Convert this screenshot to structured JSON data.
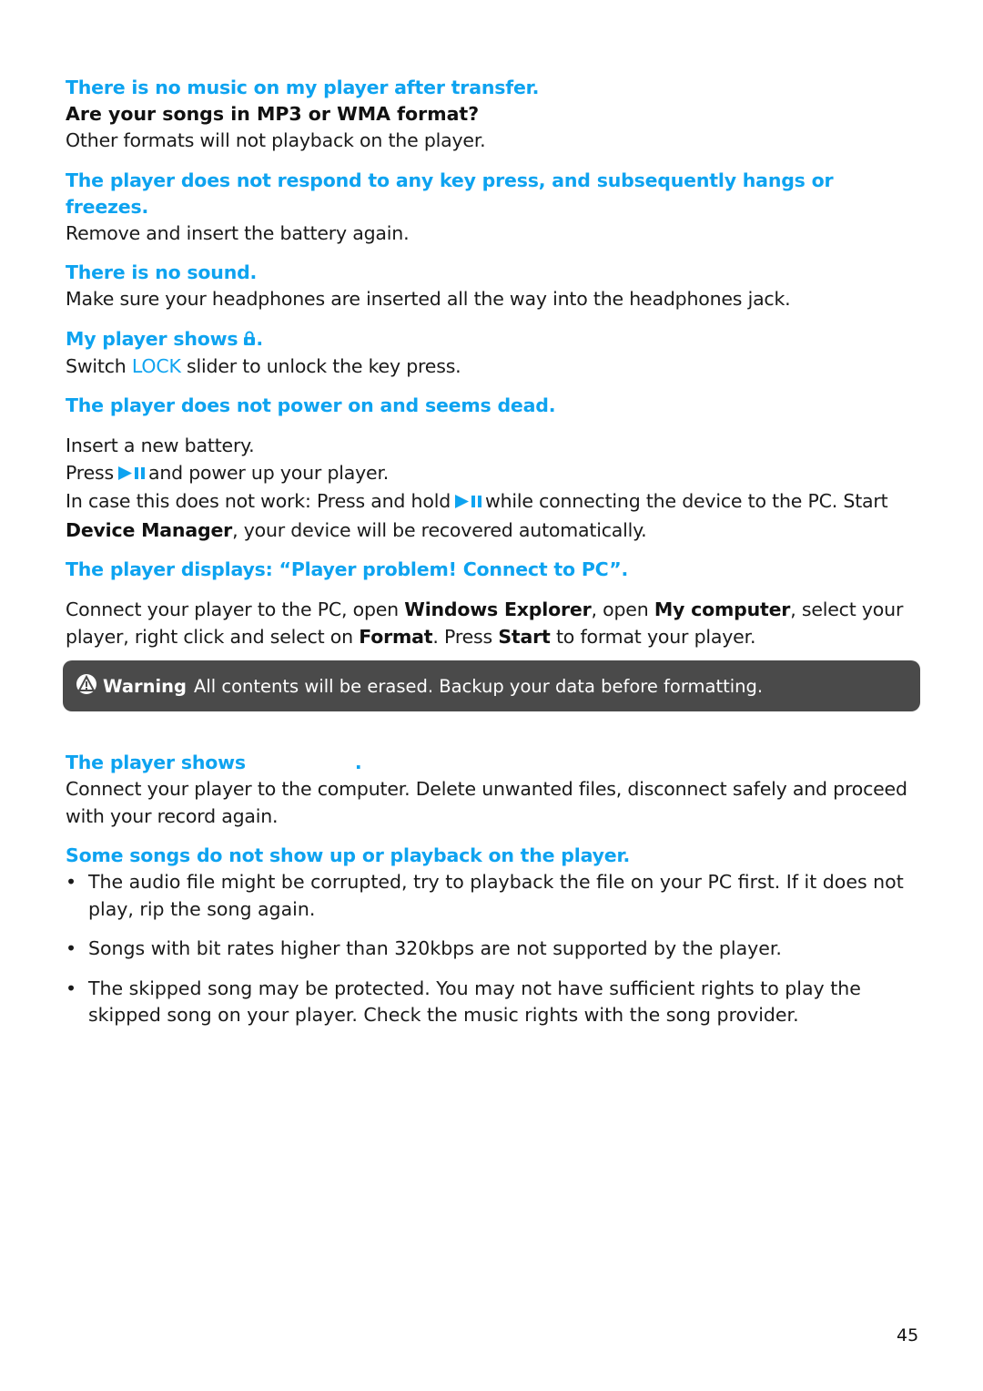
{
  "sections": [
    {
      "heading": "There is no music on my player after transfer.",
      "subheading": "Are your songs in MP3 or WMA format?",
      "body": "Other formats will not playback on the player."
    },
    {
      "heading": "The player does not respond to any key press, and subsequently hangs or freezes.",
      "body": "Remove and insert the battery again."
    },
    {
      "heading": "There is no sound.",
      "body": "Make sure your headphones are inserted all the way into the headphones jack."
    },
    {
      "heading_prefix": "My player shows",
      "heading_suffix": ".",
      "body_prefix": "Switch",
      "body_highlight": "LOCK",
      "body_suffix": "slider to unlock the key press."
    },
    {
      "heading": "The player does not power on and seems dead.",
      "line1": "Insert a new battery.",
      "line2_prefix": "Press",
      "line2_suffix": "and power up your player.",
      "line3_prefix": "In case this does not work: Press and hold",
      "line3_suffix": "while connecting the device to the PC. Start",
      "line4_bold": "Device Manager",
      "line4_suffix": ", your device will be recovered automatically."
    },
    {
      "heading": "The player displays: “Player problem! Connect to PC”.",
      "parts": {
        "t1": "Connect your player to the PC, open ",
        "b1": "Windows Explorer",
        "t2": ", open ",
        "b2": "My computer",
        "t3": ", select your player, right click and select on ",
        "b3": "Format",
        "t4": ". Press ",
        "b4": "Start",
        "t5": " to format your player."
      }
    },
    {
      "heading_prefix": "The player shows",
      "heading_suffix": ".",
      "body": "Connect your player to the computer. Delete unwanted files, disconnect safely and proceed with your record again."
    },
    {
      "heading": "Some songs do not show up or playback on the player.",
      "bullets": [
        "The audio file might be corrupted, try to playback the file on your PC first. If it does not play, rip the song again.",
        "Songs with bit rates higher than 320kbps are not supported by the player.",
        "The skipped song may be protected. You may not have sufficient rights to play the skipped song on your player. Check the music rights with the song provider."
      ]
    }
  ],
  "warning": {
    "label": "Warning",
    "text": "All contents will be erased. Backup your data before formatting.",
    "icon": "warning-triangle-icon"
  },
  "bullet_char": "•",
  "page_number": "45",
  "colors": {
    "heading_blue": "#0ea3f0",
    "warning_bg": "#4a4a4a"
  }
}
